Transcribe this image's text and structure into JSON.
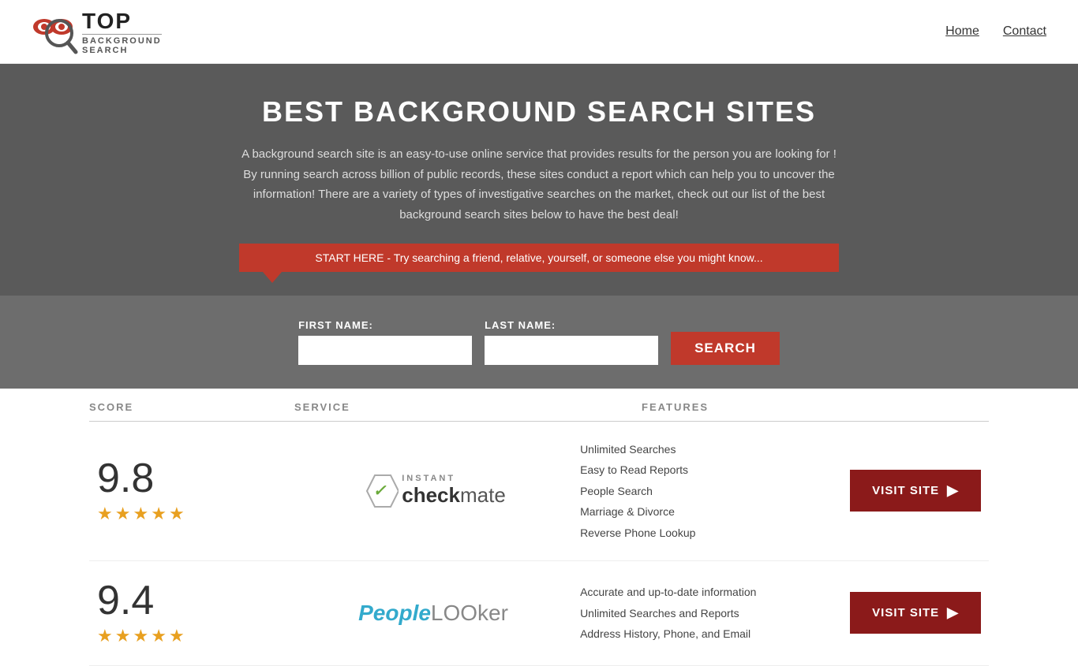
{
  "header": {
    "logo_top": "TOP",
    "logo_sub": "BACKGROUND\nSEARCH",
    "nav": [
      {
        "label": "Home",
        "id": "nav-home"
      },
      {
        "label": "Contact",
        "id": "nav-contact"
      }
    ]
  },
  "hero": {
    "title": "BEST BACKGROUND SEARCH SITES",
    "description": "A background search site is an easy-to-use online service that provides results  for the person you are looking for ! By  running  search across billion of public records, these sites conduct  a report which can help you to uncover the information! There are a variety of types of investigative searches on the market, check out our  list of the best background search sites below to have the best deal!"
  },
  "callout": {
    "text": "START HERE - Try searching a friend, relative, yourself, or someone else you might know..."
  },
  "search_form": {
    "first_name_label": "FIRST NAME:",
    "last_name_label": "LAST NAME:",
    "first_name_placeholder": "",
    "last_name_placeholder": "",
    "button_label": "SEARCH"
  },
  "table": {
    "columns": [
      {
        "id": "score",
        "label": "SCORE"
      },
      {
        "id": "service",
        "label": "SERVICE"
      },
      {
        "id": "features",
        "label": "FEATURES"
      },
      {
        "id": "action",
        "label": ""
      }
    ],
    "rows": [
      {
        "score": "9.8",
        "stars": 4.5,
        "service_name": "Instant Checkmate",
        "features": [
          "Unlimited Searches",
          "Easy to Read Reports",
          "People Search",
          "Marriage & Divorce",
          "Reverse Phone Lookup"
        ],
        "visit_label": "VISIT SITE"
      },
      {
        "score": "9.4",
        "stars": 4.5,
        "service_name": "PeopleLooker",
        "features": [
          "Accurate and up-to-date information",
          "Unlimited Searches and Reports",
          "Address History, Phone, and Email"
        ],
        "visit_label": "VISIT SITE"
      }
    ]
  }
}
